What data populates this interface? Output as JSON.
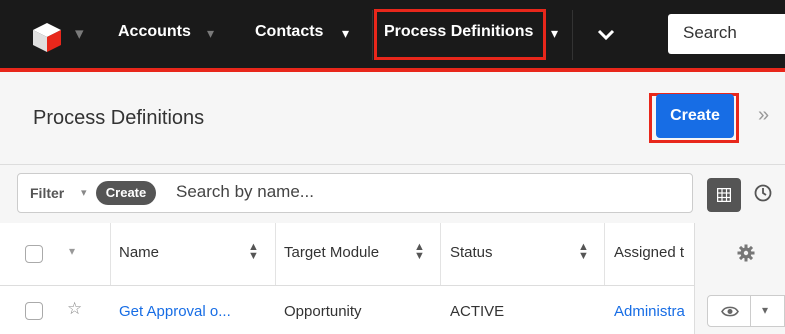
{
  "nav": {
    "items": [
      {
        "label": "Accounts"
      },
      {
        "label": "Contacts"
      },
      {
        "label": "Process Definitions"
      }
    ],
    "search_placeholder": "Search",
    "colors": {
      "bar": "#1a1a1a",
      "accent": "#e8271b"
    }
  },
  "header": {
    "title": "Process Definitions",
    "create_label": "Create",
    "create_color": "#176de5"
  },
  "filter": {
    "filter_label": "Filter",
    "create_label": "Create",
    "search_placeholder": "Search by name..."
  },
  "table": {
    "columns": [
      "Name",
      "Target Module",
      "Status",
      "Assigned t"
    ],
    "rows": [
      {
        "name": "Get Approval o...",
        "target_module": "Opportunity",
        "status": "ACTIVE",
        "assigned": "Administra"
      }
    ]
  },
  "icons": [
    "logo-icon",
    "caret-down-icon",
    "chevron-down-icon",
    "double-chevron-right-icon",
    "grid-icon",
    "clock-icon",
    "gear-icon",
    "star-icon",
    "eye-icon",
    "sort-icon"
  ]
}
